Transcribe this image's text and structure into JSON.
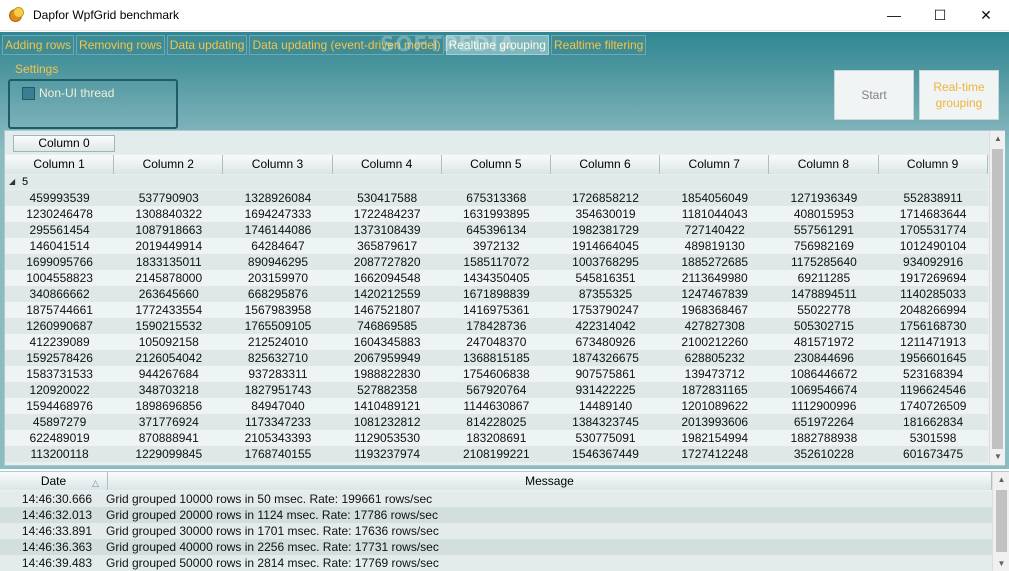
{
  "window": {
    "title": "Dapfor WpfGrid benchmark",
    "minimize": "—",
    "maximize": "☐",
    "close": "✕"
  },
  "tabs": [
    {
      "label": "Adding rows"
    },
    {
      "label": "Removing rows"
    },
    {
      "label": "Data updating"
    },
    {
      "label": "Data updating (event-driven model)"
    },
    {
      "label": "Realtime grouping"
    },
    {
      "label": "Realtime filtering"
    }
  ],
  "active_tab": "Realtime grouping",
  "watermark": "SOFTPEDIA",
  "settings": {
    "label": "Settings",
    "non_ui_thread": "Non-UI thread"
  },
  "buttons": {
    "start": "Start",
    "realtime_grouping": "Real-time grouping"
  },
  "grid": {
    "group_column": "Column 0",
    "columns": [
      "Column 1",
      "Column 2",
      "Column 3",
      "Column 4",
      "Column 5",
      "Column 6",
      "Column 7",
      "Column 8",
      "Column 9"
    ],
    "group_value": "5",
    "group_expander": "◢",
    "rows": [
      [
        "459993539",
        "537790903",
        "1328926084",
        "530417588",
        "675313368",
        "1726858212",
        "1854056049",
        "1271936349",
        "552838911"
      ],
      [
        "1230246478",
        "1308840322",
        "1694247333",
        "1722484237",
        "1631993895",
        "354630019",
        "1181044043",
        "408015953",
        "1714683644"
      ],
      [
        "295561454",
        "1087918663",
        "1746144086",
        "1373108439",
        "645396134",
        "1982381729",
        "727140422",
        "557561291",
        "1705531774"
      ],
      [
        "146041514",
        "2019449914",
        "64284647",
        "365879617",
        "3972132",
        "1914664045",
        "489819130",
        "756982169",
        "1012490104"
      ],
      [
        "1699095766",
        "1833135011",
        "890946295",
        "2087727820",
        "1585117072",
        "1003768295",
        "1885272685",
        "1175285640",
        "934092916"
      ],
      [
        "1004558823",
        "2145878000",
        "203159970",
        "1662094548",
        "1434350405",
        "545816351",
        "2113649980",
        "69211285",
        "1917269694"
      ],
      [
        "340866662",
        "263645660",
        "668295876",
        "1420212559",
        "1671898839",
        "87355325",
        "1247467839",
        "1478894511",
        "1140285033"
      ],
      [
        "1875744661",
        "1772433554",
        "1567983958",
        "1467521807",
        "1416975361",
        "1753790247",
        "1968368467",
        "55022778",
        "2048266994"
      ],
      [
        "1260990687",
        "1590215532",
        "1765509105",
        "746869585",
        "178428736",
        "422314042",
        "427827308",
        "505302715",
        "1756168730"
      ],
      [
        "412239089",
        "105092158",
        "212524010",
        "1604345883",
        "247048370",
        "673480926",
        "2100212260",
        "481571972",
        "1211471913"
      ],
      [
        "1592578426",
        "2126054042",
        "825632710",
        "2067959949",
        "1368815185",
        "1874326675",
        "628805232",
        "230844696",
        "1956601645"
      ],
      [
        "1583731533",
        "944267684",
        "937283311",
        "1988822830",
        "1754606838",
        "907575861",
        "139473712",
        "1086446672",
        "523168394"
      ],
      [
        "120920022",
        "348703218",
        "1827951743",
        "527882358",
        "567920764",
        "931422225",
        "1872831165",
        "1069546674",
        "1196624546"
      ],
      [
        "1594468976",
        "1898696856",
        "84947040",
        "1410489121",
        "1144630867",
        "14489140",
        "1201089622",
        "1112900996",
        "1740726509"
      ],
      [
        "45897279",
        "371776924",
        "1173347233",
        "1081232812",
        "814228025",
        "1384323745",
        "2013993606",
        "651972264",
        "181662834"
      ],
      [
        "622489019",
        "870888941",
        "2105343393",
        "1129053530",
        "183208691",
        "530775091",
        "1982154994",
        "1882788938",
        "5301598"
      ],
      [
        "113200118",
        "1229099845",
        "1768740155",
        "1193237974",
        "2108199221",
        "1546367449",
        "1727412248",
        "352610228",
        "601673475"
      ]
    ]
  },
  "log": {
    "date_header": "Date",
    "message_header": "Message",
    "entries": [
      {
        "time": "14:46:30.666",
        "message": "Grid grouped 10000 rows in 50 msec. Rate: 199661 rows/sec"
      },
      {
        "time": "14:46:32.013",
        "message": "Grid grouped 20000 rows in 1124 msec. Rate: 17786 rows/sec"
      },
      {
        "time": "14:46:33.891",
        "message": "Grid grouped 30000 rows in 1701 msec. Rate: 17636 rows/sec"
      },
      {
        "time": "14:46:36.363",
        "message": "Grid grouped 40000 rows in 2256 msec. Rate: 17731 rows/sec"
      },
      {
        "time": "14:46:39.483",
        "message": "Grid grouped 50000 rows in 2814 msec. Rate: 17769 rows/sec"
      }
    ]
  }
}
